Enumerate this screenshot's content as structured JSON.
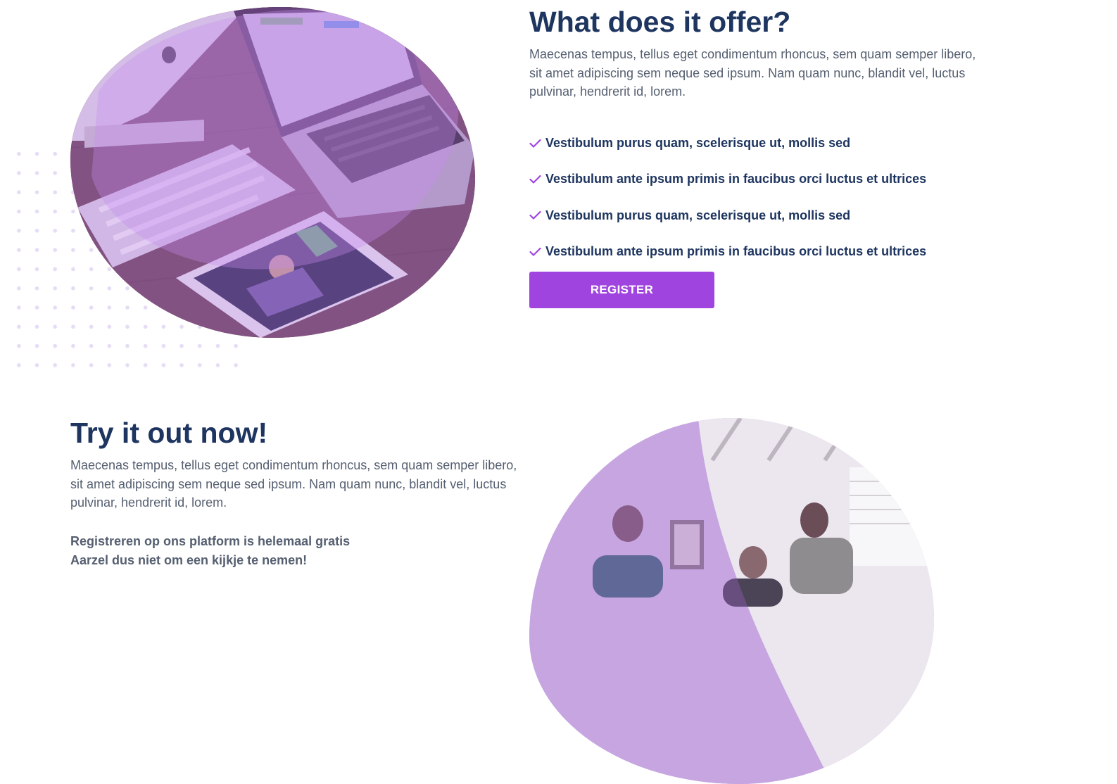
{
  "offer_section": {
    "heading": "What does it offer?",
    "description": "Maecenas tempus, tellus eget condimentum rhoncus, sem quam semper libero, sit amet adipiscing sem neque sed ipsum. Nam quam nunc, blandit vel, luctus pulvinar, hendrerit id, lorem.",
    "features": [
      {
        "label": "Vestibulum purus quam, scelerisque ut, mollis sed",
        "icon": "check-icon"
      },
      {
        "label": "Vestibulum ante ipsum primis in faucibus orci luctus et ultrices",
        "icon": "check-icon"
      },
      {
        "label": "Vestibulum purus quam, scelerisque ut, mollis sed",
        "icon": "check-icon"
      },
      {
        "label": "Vestibulum ante ipsum primis in faucibus orci luctus et ultrices",
        "icon": "check-icon"
      }
    ],
    "register_label": "REGISTER",
    "image_icon": "devices-photo"
  },
  "try_section": {
    "heading": "Try it out now!",
    "description": "Maecenas tempus, tellus eget condimentum rhoncus, sem quam semper libero, sit amet adipiscing sem neque sed ipsum. Nam quam nunc, blandit vel, luctus pulvinar, hendrerit id, lorem.",
    "note_line1": "Registreren op ons platform is helemaal gratis",
    "note_line2": "Aarzel dus niet om een kijkje te nemen!",
    "image_icon": "team-photo"
  },
  "colors": {
    "heading": "#1e3560",
    "body_text": "#555f70",
    "accent": "#a044e0",
    "dots": "#e6dcf5"
  }
}
